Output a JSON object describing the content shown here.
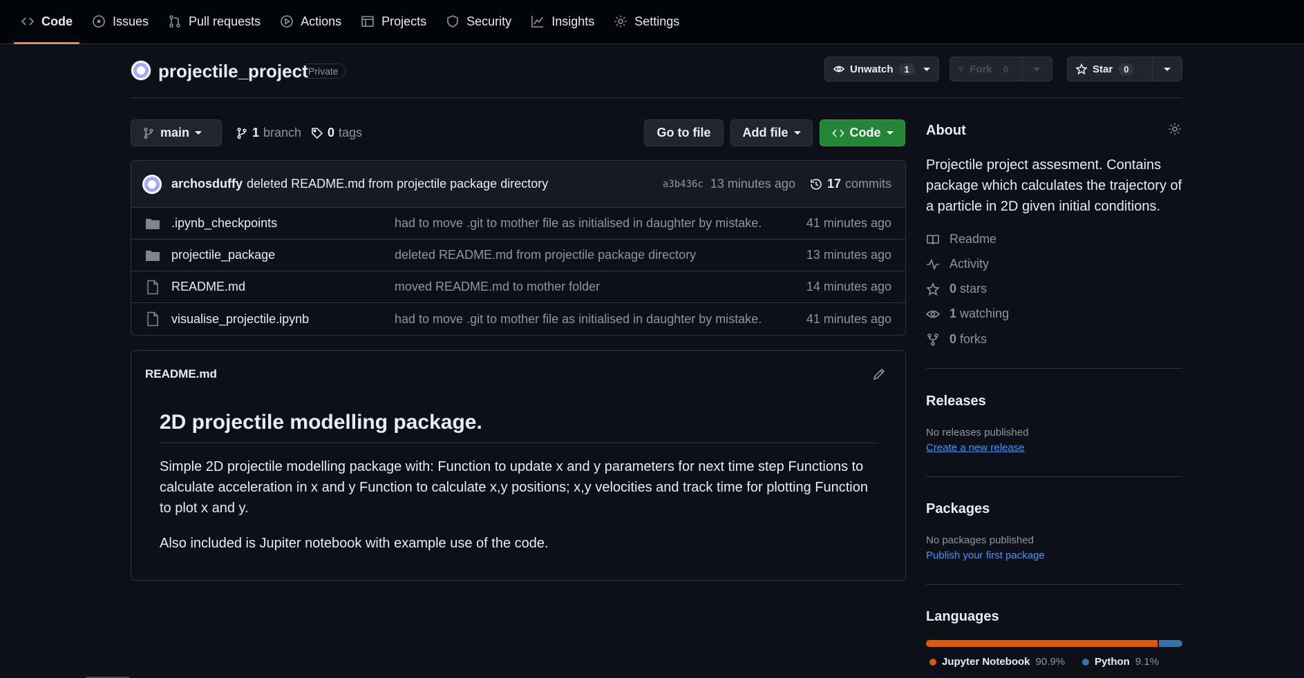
{
  "nav": {
    "tabs": [
      {
        "label": "Code",
        "icon": "code-icon",
        "active": true
      },
      {
        "label": "Issues",
        "icon": "issue-icon"
      },
      {
        "label": "Pull requests",
        "icon": "pull-request-icon"
      },
      {
        "label": "Actions",
        "icon": "play-icon"
      },
      {
        "label": "Projects",
        "icon": "table-icon"
      },
      {
        "label": "Security",
        "icon": "shield-icon"
      },
      {
        "label": "Insights",
        "icon": "graph-icon"
      },
      {
        "label": "Settings",
        "icon": "gear-icon"
      }
    ]
  },
  "repo": {
    "name": "projectile_project",
    "visibility": "Private",
    "unwatch_label": "Unwatch",
    "watch_count": "1",
    "fork_label": "Fork",
    "fork_count": "0",
    "star_label": "Star",
    "star_count": "0"
  },
  "branchbar": {
    "branch": "main",
    "branch_count": "1",
    "branch_label": "branch",
    "tag_count": "0",
    "tag_label": "tags",
    "go_to_file": "Go to file",
    "add_file": "Add file",
    "code": "Code"
  },
  "commit": {
    "author": "archosduffy",
    "message": "deleted README.md from projectile package directory",
    "sha": "a3b436c",
    "time": "13 minutes ago",
    "commit_count": "17",
    "commit_label": "commits"
  },
  "files": [
    {
      "type": "folder",
      "name": ".ipynb_checkpoints",
      "message": "had to move .git to mother file as initialised in daughter by mistake.",
      "time": "41 minutes ago"
    },
    {
      "type": "folder",
      "name": "projectile_package",
      "message": "deleted README.md from projectile package directory",
      "time": "13 minutes ago"
    },
    {
      "type": "file",
      "name": "README.md",
      "message": "moved README.md to mother folder",
      "time": "14 minutes ago"
    },
    {
      "type": "file",
      "name": "visualise_projectile.ipynb",
      "message": "had to move .git to mother file as initialised in daughter by mistake.",
      "time": "41 minutes ago"
    }
  ],
  "readme": {
    "filename": "README.md",
    "heading": "2D projectile modelling package.",
    "para1": "Simple 2D projectile modelling package with: Function to update x and y parameters for next time step Functions to calculate acceleration in x and y Function to calculate x,y positions; x,y velocities and track time for plotting Function to plot x and y.",
    "para2": "Also included is Jupiter notebook with example use of the code."
  },
  "sidebar": {
    "about_title": "About",
    "about_text": "Projectile project assesment. Contains package which calculates the trajectory of a particle in 2D given initial conditions.",
    "readme": "Readme",
    "activity": "Activity",
    "stars_count": "0",
    "stars_label": "stars",
    "watching_count": "1",
    "watching_label": "watching",
    "forks_count": "0",
    "forks_label": "forks",
    "releases_title": "Releases",
    "releases_sub": "No releases published",
    "releases_link": "Create a new release",
    "packages_title": "Packages",
    "packages_sub": "No packages published",
    "packages_link": "Publish your first package",
    "languages_title": "Languages",
    "languages": [
      {
        "name": "Jupyter Notebook",
        "percent": "90.9%",
        "value": 90.9,
        "color": "#DA5B0B"
      },
      {
        "name": "Python",
        "percent": "9.1%",
        "value": 9.1,
        "color": "#3572A5"
      }
    ]
  },
  "colors": {
    "background": "#0d1117",
    "accent_tab": "#f78166",
    "green_button": "#238636",
    "link": "#4493f8"
  }
}
